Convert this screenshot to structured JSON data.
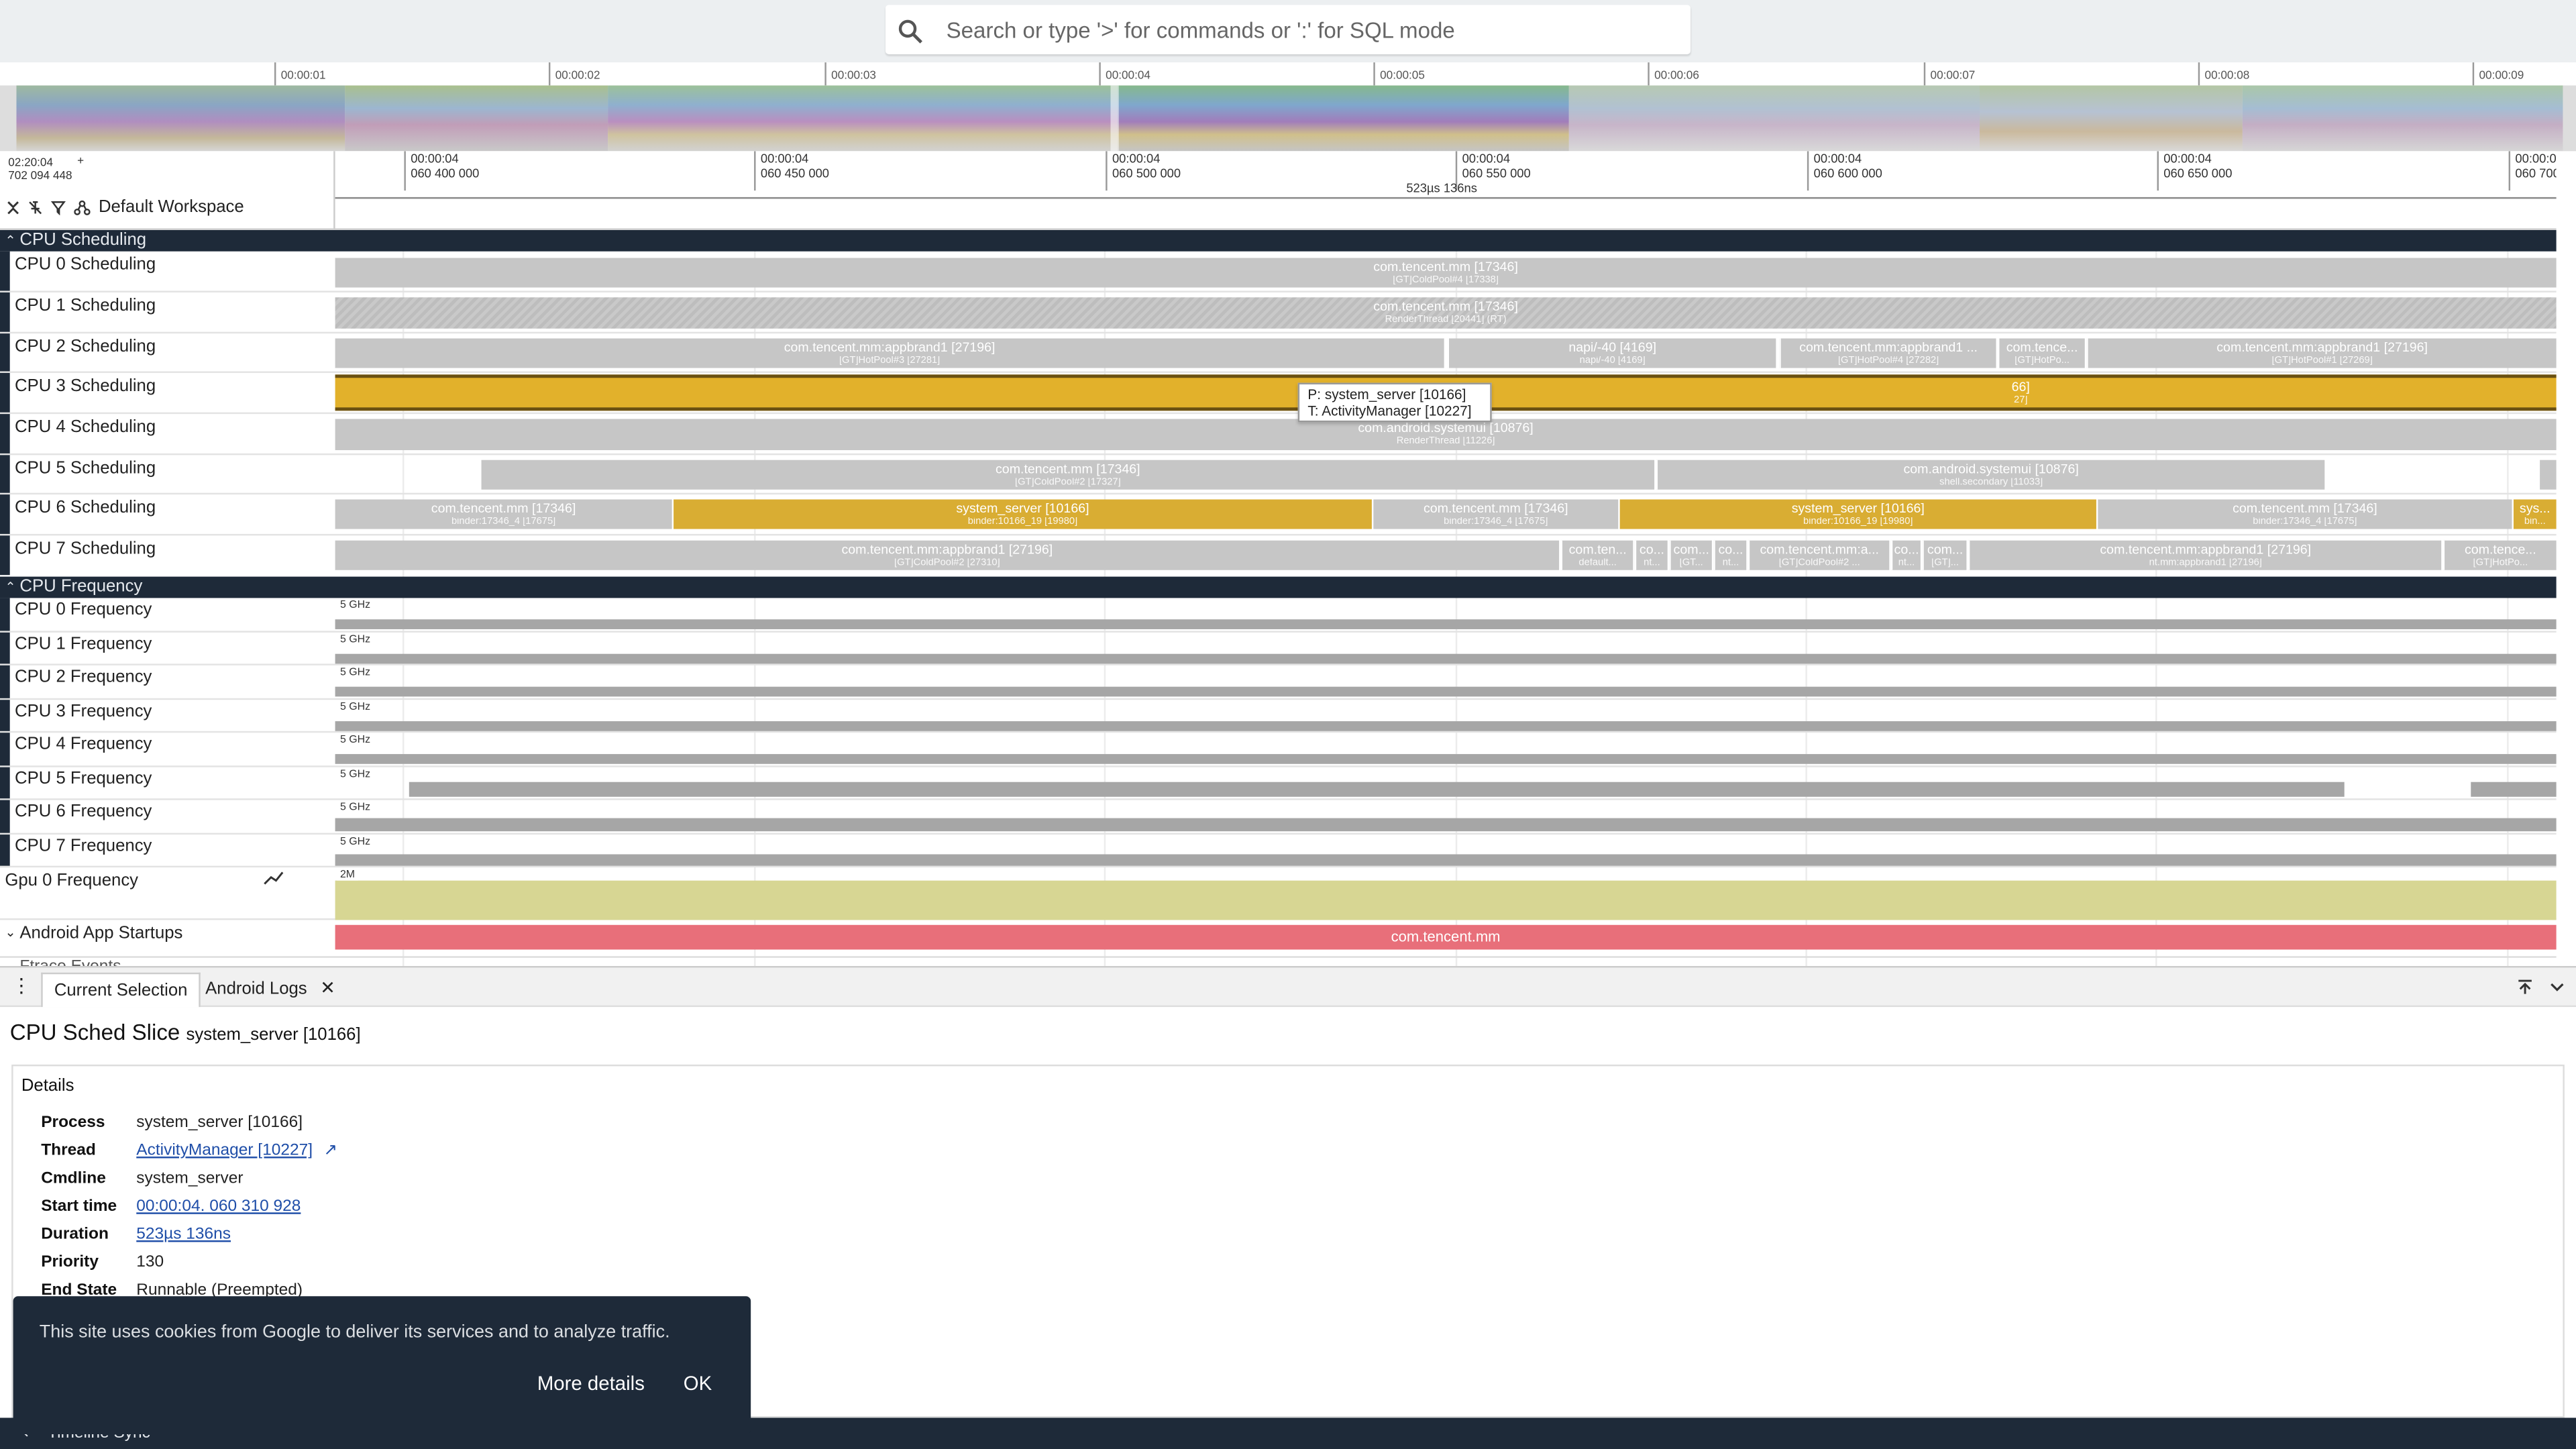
{
  "search": {
    "placeholder": "Search or type '>' for commands or ':' for SQL mode"
  },
  "overview": {
    "ticks": [
      "00:00:01",
      "00:00:02",
      "00:00:03",
      "00:00:04",
      "00:00:05",
      "00:00:06",
      "00:00:07",
      "00:00:08",
      "00:00:09"
    ]
  },
  "timeline": {
    "origin_top": "02:20:04",
    "origin_bottom": "702 094 448",
    "origin_plus": "+",
    "ticks": [
      {
        "top": "00:00:04",
        "bottom": "060 400 000"
      },
      {
        "top": "00:00:04",
        "bottom": "060 450 000"
      },
      {
        "top": "00:00:04",
        "bottom": "060 500 000"
      },
      {
        "top": "00:00:04",
        "bottom": "060 550 000"
      },
      {
        "top": "00:00:04",
        "bottom": "060 600 000"
      },
      {
        "top": "00:00:04",
        "bottom": "060 650 000"
      },
      {
        "top": "00:00:0",
        "bottom": "060 700"
      }
    ],
    "selection_duration": "523µs 136ns",
    "workspace": "Default Workspace"
  },
  "groups": {
    "cpu_sched": "CPU Scheduling",
    "cpu_freq": "CPU Frequency",
    "startups": "Android App Startups",
    "ftrace": "Ftrace Events"
  },
  "sched_tracks": [
    {
      "label": "CPU 0 Scheduling",
      "slices": [
        {
          "p": "com.tencent.mm [17346]",
          "t": "[GT]ColdPool#4 [17338]"
        }
      ]
    },
    {
      "label": "CPU 1 Scheduling",
      "slices": [
        {
          "p": "com.tencent.mm [17346]",
          "t": "RenderThread [20441] (RT)"
        }
      ]
    },
    {
      "label": "CPU 2 Scheduling",
      "slices": [
        {
          "p": "com.tencent.mm:appbrand1 [27196]",
          "t": "[GT]HotPool#3 [27281]"
        },
        {
          "p": "napi/-40 [4169]",
          "t": "napi/-40 [4169]"
        },
        {
          "p": "com.tencent.mm:appbrand1 ...",
          "t": "[GT]HotPool#4 [27282]"
        },
        {
          "p": "com.tence...",
          "t": "[GT]HotPo..."
        },
        {
          "p": "com.tencent.mm:appbrand1 [27196]",
          "t": "[GT]HotPool#1 [27269]"
        }
      ]
    },
    {
      "label": "CPU 3 Scheduling",
      "slices": [
        {
          "p": "66]",
          "t": "27]"
        }
      ]
    },
    {
      "label": "CPU 4 Scheduling",
      "slices": [
        {
          "p": "com.android.systemui [10876]",
          "t": "RenderThread [11226]"
        }
      ]
    },
    {
      "label": "CPU 5 Scheduling",
      "slices": [
        {
          "p": "com.tencent.mm [17346]",
          "t": "[GT]ColdPool#2 [17327]"
        },
        {
          "p": "com.android.systemui [10876]",
          "t": "shell.secondary [11033]"
        }
      ]
    },
    {
      "label": "CPU 6 Scheduling",
      "slices": [
        {
          "p": "com.tencent.mm [17346]",
          "t": "binder:17346_4 [17675]"
        },
        {
          "p": "system_server [10166]",
          "t": "binder:10166_19 [19980]"
        },
        {
          "p": "com.tencent.mm [17346]",
          "t": "binder:17346_4 [17675]"
        },
        {
          "p": "system_server [10166]",
          "t": "binder:10166_19 [19980]"
        },
        {
          "p": "com.tencent.mm [17346]",
          "t": "binder:17346_4 [17675]"
        },
        {
          "p": "sys...",
          "t": "bin..."
        }
      ]
    },
    {
      "label": "CPU 7 Scheduling",
      "slices": [
        {
          "p": "com.tencent.mm:appbrand1 [27196]",
          "t": "[GT]ColdPool#2 [27310]"
        },
        {
          "p": "com.ten...",
          "t": "default..."
        },
        {
          "p": "co...",
          "t": "nt..."
        },
        {
          "p": "com...",
          "t": "[GT..."
        },
        {
          "p": "co...",
          "t": "nt..."
        },
        {
          "p": "com.tencent.mm:a...",
          "t": "[GT]ColdPool#2 ..."
        },
        {
          "p": "co...",
          "t": "nt..."
        },
        {
          "p": "com...",
          "t": "[GT]..."
        },
        {
          "p": "com.tencent.mm:appbrand1 [27196]",
          "t": "nt.mm:appbrand1 [27196]"
        },
        {
          "p": "com.tence...",
          "t": "[GT]HotPo..."
        }
      ]
    }
  ],
  "freq_tracks": [
    {
      "label": "CPU 0 Frequency",
      "scale": "5 GHz"
    },
    {
      "label": "CPU 1 Frequency",
      "scale": "5 GHz"
    },
    {
      "label": "CPU 2 Frequency",
      "scale": "5 GHz"
    },
    {
      "label": "CPU 3 Frequency",
      "scale": "5 GHz"
    },
    {
      "label": "CPU 4 Frequency",
      "scale": "5 GHz"
    },
    {
      "label": "CPU 5 Frequency",
      "scale": "5 GHz"
    },
    {
      "label": "CPU 6 Frequency",
      "scale": "5 GHz"
    },
    {
      "label": "CPU 7 Frequency",
      "scale": "5 GHz"
    }
  ],
  "gpu": {
    "label": "Gpu 0 Frequency",
    "scale": "2M"
  },
  "startup": {
    "slice": "com.tencent.mm"
  },
  "tooltip": {
    "p": "P: system_server [10166]",
    "t": "T: ActivityManager [10227]"
  },
  "tabs": {
    "current": "Current Selection",
    "logs": "Android Logs"
  },
  "details": {
    "title": "CPU Sched Slice",
    "subtitle": "system_server [10166]",
    "section": "Details",
    "rows": [
      {
        "k": "Process",
        "v": "system_server [10166]"
      },
      {
        "k": "Thread",
        "v": "ActivityManager [10227]"
      },
      {
        "k": "Cmdline",
        "v": "system_server"
      },
      {
        "k": "Start time",
        "v": "00:00:04. 060 310 928"
      },
      {
        "k": "Duration",
        "v": "523µs 136ns"
      },
      {
        "k": "Priority",
        "v": "130"
      },
      {
        "k": "End State",
        "v": "Runnable (Preempted)"
      }
    ]
  },
  "statusbar": {
    "label": "Timeline Sync"
  },
  "cookie": {
    "message": "This site uses cookies from Google to deliver its services and to analyze traffic.",
    "more": "More details",
    "ok": "OK"
  }
}
